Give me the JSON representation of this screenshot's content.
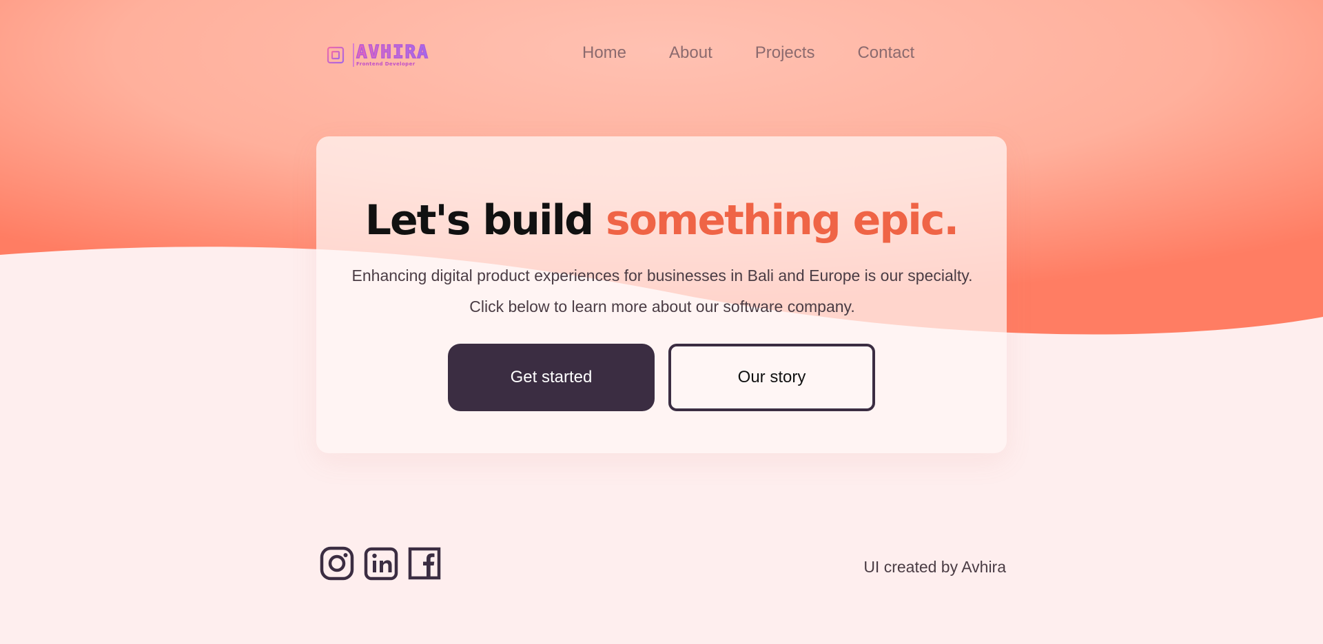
{
  "brand": {
    "name": "AVHIRA",
    "tagline": "Frontend Developer"
  },
  "nav": {
    "items": [
      "Home",
      "About",
      "Projects",
      "Contact"
    ]
  },
  "hero": {
    "headline_plain": "Let's build ",
    "headline_accent": "something epic.",
    "subtitle": "Enhancing digital product experiences for businesses in Bali and Europe is our specialty. Click below to learn more about our software company.",
    "primary_button": "Get started",
    "secondary_button": "Our story"
  },
  "footer": {
    "social_icons": [
      "instagram-icon",
      "linkedin-icon",
      "facebook-icon"
    ],
    "credit": "UI created by Avhira"
  },
  "colors": {
    "accent": "#ef6446",
    "dark": "#3b2d42",
    "page_bg": "#feeeee",
    "wave_top": "#ffb8a6",
    "wave_edge": "#ff7a60"
  }
}
